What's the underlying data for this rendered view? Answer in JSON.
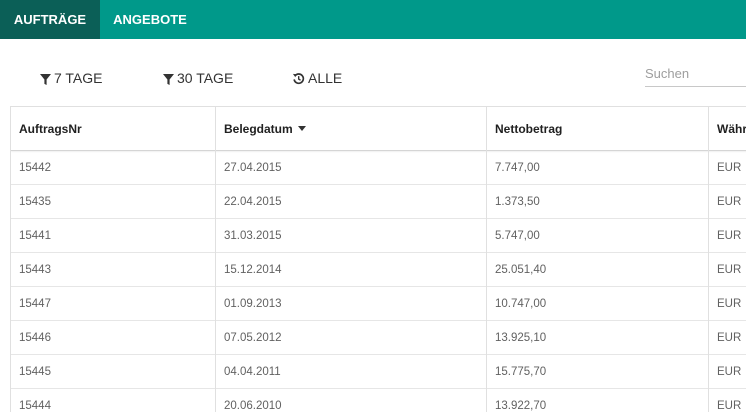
{
  "tabs": [
    {
      "label": "AUFTRÄGE"
    },
    {
      "label": "ANGEBOTE"
    }
  ],
  "filters": [
    {
      "label": "7 TAGE",
      "icon": "filter-icon"
    },
    {
      "label": "30 TAGE",
      "icon": "filter-icon"
    },
    {
      "label": "ALLE",
      "icon": "history-reset-icon"
    }
  ],
  "search": {
    "placeholder": "Suchen"
  },
  "table": {
    "columns": [
      {
        "label": "AuftragsNr"
      },
      {
        "label": "Belegdatum",
        "sorted": "descending"
      },
      {
        "label": "Nettobetrag"
      },
      {
        "label": "Währung"
      }
    ],
    "rows": [
      [
        "15442",
        "27.04.2015",
        "7.747,00",
        "EUR"
      ],
      [
        "15435",
        "22.04.2015",
        "1.373,50",
        "EUR"
      ],
      [
        "15441",
        "31.03.2015",
        "5.747,00",
        "EUR"
      ],
      [
        "15443",
        "15.12.2014",
        "25.051,40",
        "EUR"
      ],
      [
        "15447",
        "01.09.2013",
        "10.747,00",
        "EUR"
      ],
      [
        "15446",
        "07.05.2012",
        "13.925,10",
        "EUR"
      ],
      [
        "15445",
        "04.04.2011",
        "15.775,70",
        "EUR"
      ],
      [
        "15444",
        "20.06.2010",
        "13.922,70",
        "EUR"
      ]
    ]
  },
  "colors": {
    "primary": "#00998a",
    "active_tab": "#0b5f57"
  }
}
